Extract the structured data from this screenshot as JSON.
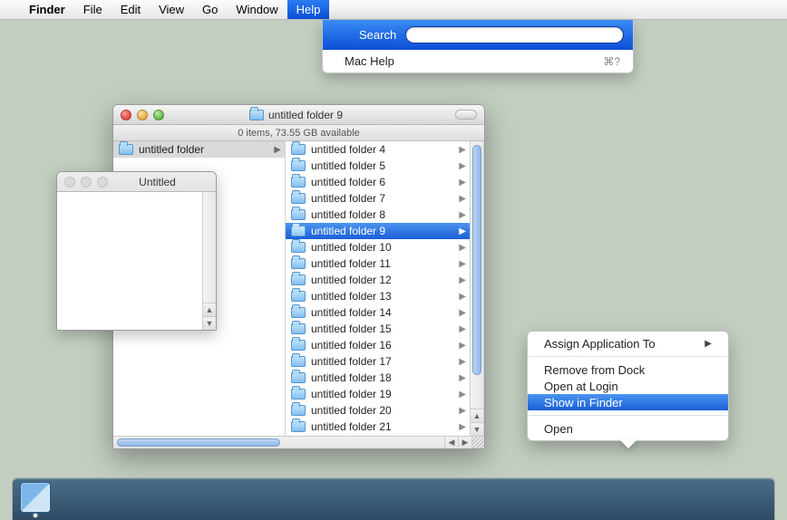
{
  "menubar": {
    "apple": "",
    "app": "Finder",
    "items": [
      "File",
      "Edit",
      "View",
      "Go",
      "Window",
      "Help"
    ],
    "selected": "Help"
  },
  "help_menu": {
    "search_label": "Search",
    "search_value": "",
    "item": "Mac Help",
    "shortcut": "⌘?"
  },
  "finder_window": {
    "title": "untitled folder 9",
    "status": "0 items, 73.55 GB available",
    "left_selected": "untitled folder",
    "right_selected_index": 5,
    "folders": [
      "untitled folder 4",
      "untitled folder 5",
      "untitled folder 6",
      "untitled folder 7",
      "untitled folder 8",
      "untitled folder 9",
      "untitled folder 10",
      "untitled folder 11",
      "untitled folder 12",
      "untitled folder 13",
      "untitled folder 14",
      "untitled folder 15",
      "untitled folder 16",
      "untitled folder 17",
      "untitled folder 18",
      "untitled folder 19",
      "untitled folder 20",
      "untitled folder 21"
    ]
  },
  "textedit_window": {
    "title": "Untitled"
  },
  "context_menu": {
    "items": [
      {
        "label": "Assign Application To",
        "submenu": true
      },
      {
        "sep": true
      },
      {
        "label": "Remove from Dock"
      },
      {
        "label": "Open at Login"
      },
      {
        "label": "Show in Finder",
        "selected": true
      },
      {
        "sep": true
      },
      {
        "label": "Open"
      }
    ]
  },
  "dock": {
    "finder_running": true
  }
}
